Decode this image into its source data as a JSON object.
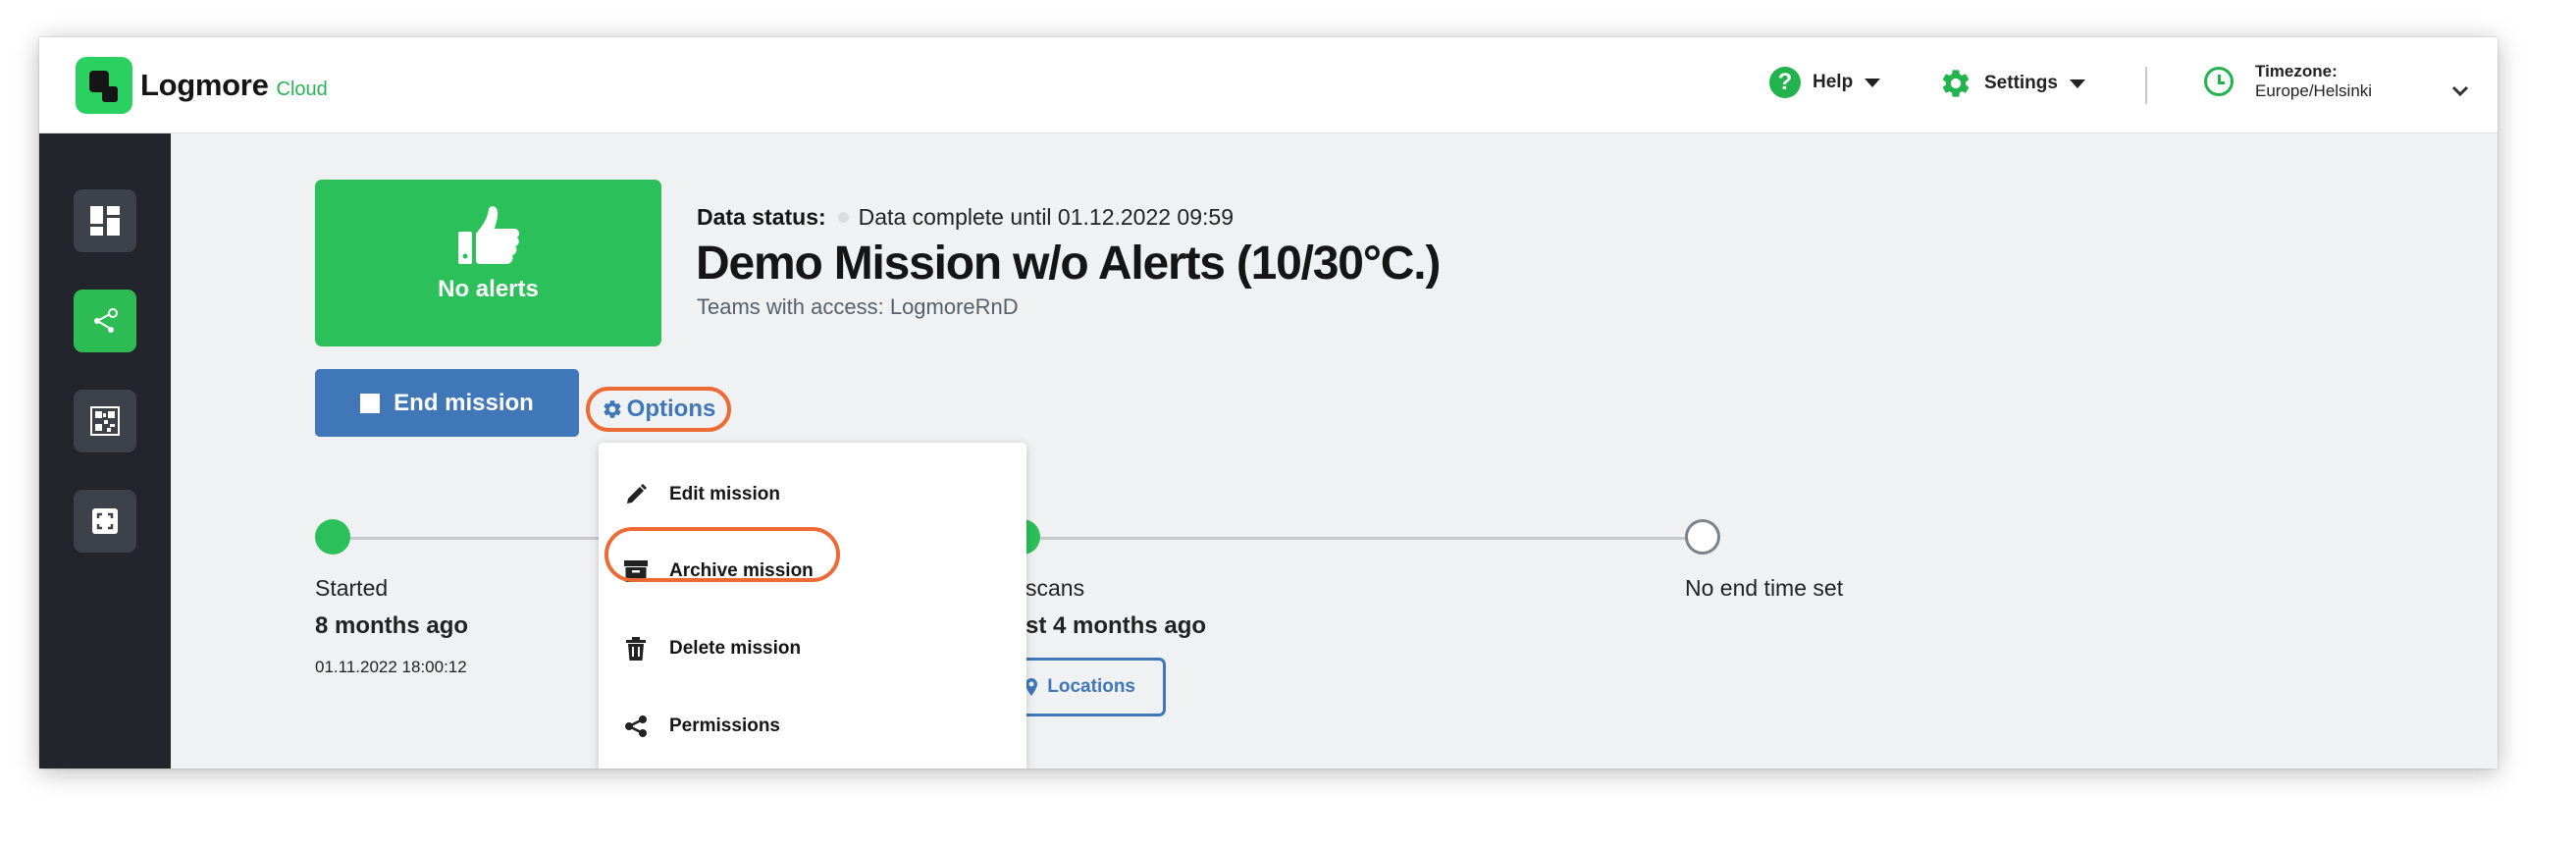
{
  "brand": {
    "name": "Logmore",
    "sub": "Cloud"
  },
  "header": {
    "help_label": "Help",
    "settings_label": "Settings",
    "timezone_label": "Timezone:",
    "timezone_value": "Europe/Helsinki"
  },
  "sidebar": {
    "items": [
      {
        "icon": "dashboard-icon",
        "active": false
      },
      {
        "icon": "share-icon",
        "active": true
      },
      {
        "icon": "qr-code-icon",
        "active": false
      },
      {
        "icon": "scan-icon",
        "active": false
      }
    ]
  },
  "mission": {
    "alert_label": "No alerts",
    "data_status_key": "Data status:",
    "data_status_value": "Data complete until 01.12.2022 09:59",
    "title": "Demo Mission w/o Alerts (10/30°C.)",
    "teams": "Teams with access: LogmoreRnD",
    "end_button": "End mission",
    "options_button": "Options"
  },
  "timeline": {
    "started_label": "Started",
    "started_relative": "8 months ago",
    "started_timestamp": "01.11.2022 18:00:12",
    "scans_label": "scans",
    "scans_relative": "st 4 months ago",
    "locations_button": "Locations",
    "end_label": "No end time set"
  },
  "options_menu": {
    "items": [
      {
        "label": "Edit mission",
        "icon": "pencil-icon"
      },
      {
        "label": "Archive mission",
        "icon": "archive-icon",
        "highlighted": true
      },
      {
        "label": "Delete mission",
        "icon": "trash-icon"
      },
      {
        "label": "Permissions",
        "icon": "share-icon"
      }
    ]
  },
  "colors": {
    "brand_green": "#2cc05a",
    "primary_blue": "#3f77b8",
    "highlight_orange": "#ee6a34",
    "sidebar_dark": "#22262c"
  }
}
